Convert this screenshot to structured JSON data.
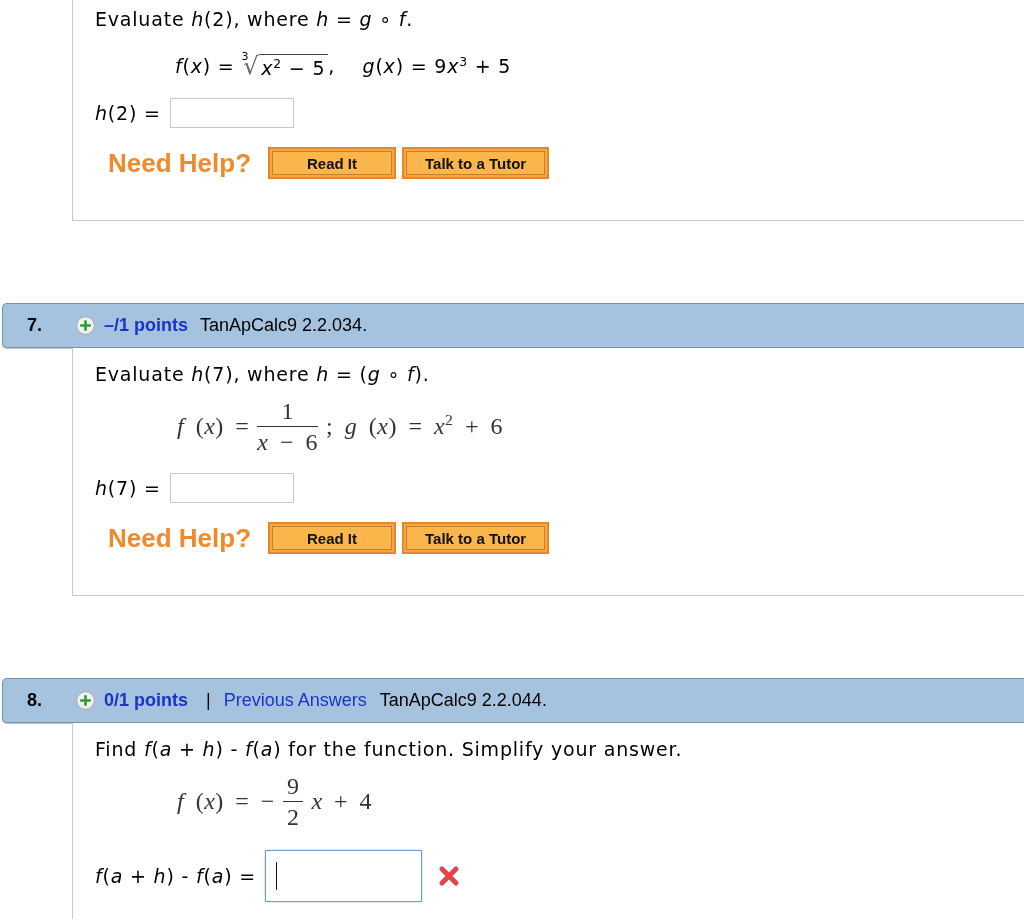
{
  "questions": [
    {
      "prompt": "Evaluate *h*(2), where *h* = *g* ∘ *f*.",
      "formula": {
        "kind": "plain",
        "parts": [
          {
            "kind": "text",
            "text": "*f*(*x*) = "
          },
          {
            "kind": "root",
            "index": "3",
            "sign": "√",
            "radicand": "*x*$^{2}$ − 5"
          },
          {
            "kind": "text",
            "text": ",    *g*(*x*) = 9"
          },
          {
            "kind": "text",
            "text": "*x*$^{3}$ + 5"
          }
        ]
      },
      "answer": {
        "kind": "number",
        "label": "*h*(2) =",
        "focused": false,
        "marked_incorrect": false
      },
      "help": {
        "label": "Need Help?",
        "buttons": [
          "Read It",
          "Talk to a Tutor"
        ]
      }
    },
    {
      "header": {
        "number": "7.",
        "points": "–/1 points",
        "source": "TanApCalc9 2.2.034."
      },
      "prompt": "Evaluate *h*(7), where *h* = (*g* ∘ *f*).",
      "formula": {
        "kind": "typeset",
        "parts": [
          {
            "kind": "text",
            "text": "*f* (*x*) ="
          },
          {
            "kind": "fraction",
            "numerator": "1",
            "denominator": "*x* − 6"
          },
          {
            "kind": "text",
            "text": "; *g* (*x*) = *x*$^{2}$ + 6"
          }
        ]
      },
      "answer": {
        "kind": "number",
        "label": "*h*(7) =",
        "focused": false,
        "marked_incorrect": false
      },
      "help": {
        "label": "Need Help?",
        "buttons": [
          "Read It",
          "Talk to a Tutor"
        ]
      }
    },
    {
      "header": {
        "number": "8.",
        "points": "0/1 points",
        "separator": "|",
        "link": "Previous Answers",
        "source": "TanApCalc9 2.2.044."
      },
      "prompt": "Find *f*(*a* + *h*) - *f*(*a*) for the function. Simplify your answer.",
      "formula": {
        "kind": "typeset",
        "parts": [
          {
            "kind": "text",
            "text": "*f* (*x*) = −"
          },
          {
            "kind": "fraction",
            "numerator": "9",
            "denominator": "2"
          },
          {
            "kind": "text",
            "text": "*x* + 4"
          }
        ]
      },
      "answer": {
        "kind": "expression",
        "label": "*f*(*a* + *h*) - *f*(*a*) =",
        "focused": true,
        "marked_incorrect": true
      }
    }
  ]
}
